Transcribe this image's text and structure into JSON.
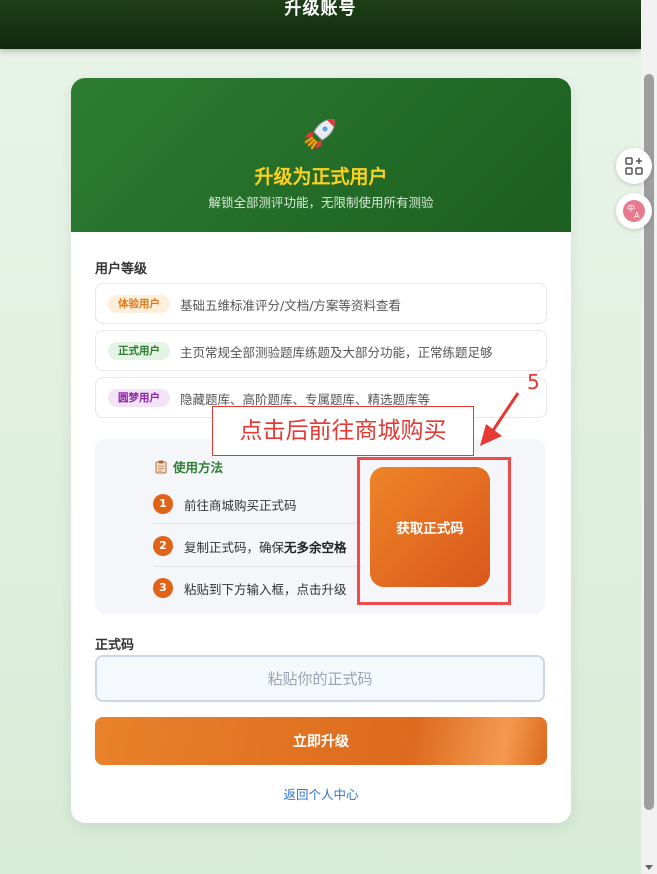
{
  "topbar": {
    "title": "升级账号"
  },
  "header": {
    "icon": "rocket-icon",
    "title": "升级为正式用户",
    "subtitle": "解锁全部测评功能，无限制使用所有测验"
  },
  "levels": {
    "section_label": "用户等级",
    "items": [
      {
        "badge": "体验用户",
        "desc": "基础五维标准评分/文档/方案等资料查看",
        "badge_color": "#e07a1f",
        "badge_bg": "#fdefd9"
      },
      {
        "badge": "正式用户",
        "desc": "主页常规全部测验题库练题及大部分功能，正常练题足够",
        "badge_color": "#2e7d32",
        "badge_bg": "#e4f3e4"
      },
      {
        "badge": "圆梦用户",
        "desc": "隐藏题库、高阶题库、专属题库、精选题库等",
        "badge_color": "#8e24aa",
        "badge_bg": "#f3e3f6"
      }
    ]
  },
  "usage": {
    "title": "使用方法",
    "steps": [
      {
        "num": "1",
        "text": "前往商城购买正式码"
      },
      {
        "num": "2",
        "text_prefix": "复制正式码，确保",
        "text_bold": "无多余空格"
      },
      {
        "num": "3",
        "text": "粘贴到下方输入框，点击升级"
      }
    ],
    "get_code_button": "获取正式码"
  },
  "code": {
    "label": "正式码",
    "placeholder": "粘贴你的正式码",
    "value": ""
  },
  "upgrade_button": "立即升级",
  "back_link": "返回个人中心",
  "annotation": {
    "label": "点击后前往商城购买",
    "step_number": "5",
    "color": "#e53935"
  },
  "colors": {
    "brand_green": "#2e7d32",
    "accent_orange": "#e0631a",
    "title_yellow": "#ffd21f",
    "link_blue": "#2f72d6"
  }
}
